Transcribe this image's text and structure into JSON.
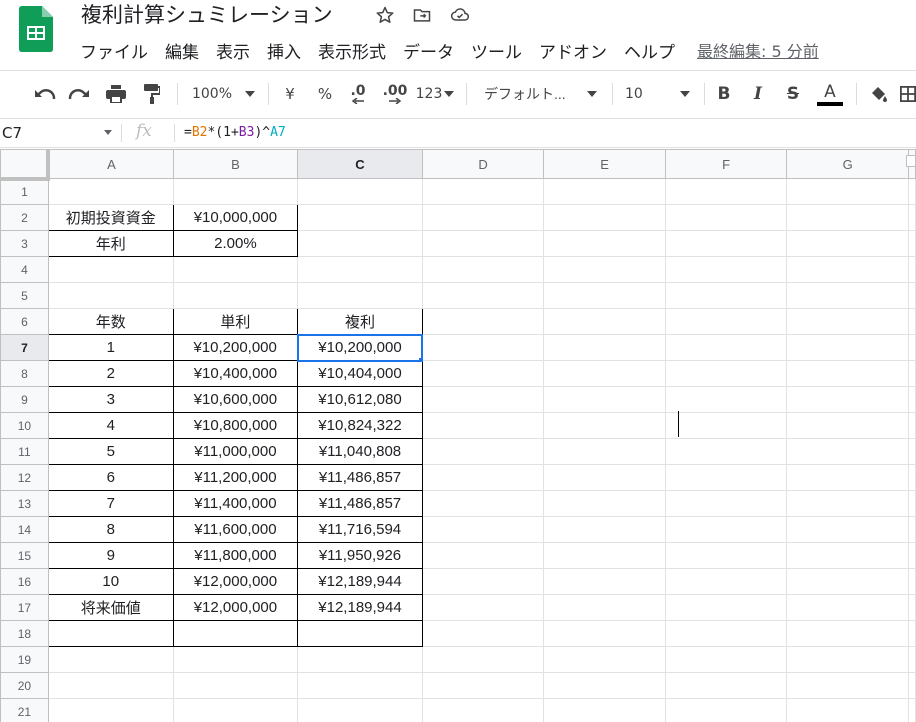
{
  "app": {
    "doc_title": "複利計算シュミレーション",
    "brand_color": "#0f9d58",
    "title_icons": [
      "star-icon",
      "move-to-folder-icon",
      "cloud-saved-icon"
    ]
  },
  "menu": {
    "items": [
      "ファイル",
      "編集",
      "表示",
      "挿入",
      "表示形式",
      "データ",
      "ツール",
      "アドオン",
      "ヘルプ"
    ],
    "last_edit": "最終編集: 5 分前"
  },
  "toolbar": {
    "zoom": "100%",
    "currency": "¥",
    "percent": "%",
    "decrease_decimal": ".0",
    "increase_decimal": ".00",
    "more_formats": "123",
    "font": "デフォルト...",
    "font_size": "10",
    "bold": "B",
    "italic": "I",
    "strikethrough": "S",
    "text_color": "A"
  },
  "formula_bar": {
    "cell_ref": "C7",
    "fx": "fx",
    "formula_parts": [
      {
        "t": "=",
        "c": "#202124"
      },
      {
        "t": "B2",
        "c": "#e37400"
      },
      {
        "t": "*(1+",
        "c": "#202124"
      },
      {
        "t": "B3",
        "c": "#7b1fa2"
      },
      {
        "t": ")^",
        "c": "#202124"
      },
      {
        "t": "A7",
        "c": "#00acc1"
      }
    ]
  },
  "sheet": {
    "columns": [
      "A",
      "B",
      "C",
      "D",
      "E",
      "F",
      "G"
    ],
    "selected_column": "C",
    "selected_row": 7,
    "rows": [
      {
        "n": "1",
        "a": "",
        "b": "",
        "c": ""
      },
      {
        "n": "2",
        "a": "初期投資資金",
        "b": "¥10,000,000",
        "c": ""
      },
      {
        "n": "3",
        "a": "年利",
        "b": "2.00%",
        "c": ""
      },
      {
        "n": "4",
        "a": "",
        "b": "",
        "c": ""
      },
      {
        "n": "5",
        "a": "",
        "b": "",
        "c": ""
      },
      {
        "n": "6",
        "a": "年数",
        "b": "単利",
        "c": "複利"
      },
      {
        "n": "7",
        "a": "1",
        "b": "¥10,200,000",
        "c": "¥10,200,000"
      },
      {
        "n": "8",
        "a": "2",
        "b": "¥10,400,000",
        "c": "¥10,404,000"
      },
      {
        "n": "9",
        "a": "3",
        "b": "¥10,600,000",
        "c": "¥10,612,080"
      },
      {
        "n": "10",
        "a": "4",
        "b": "¥10,800,000",
        "c": "¥10,824,322"
      },
      {
        "n": "11",
        "a": "5",
        "b": "¥11,000,000",
        "c": "¥11,040,808"
      },
      {
        "n": "12",
        "a": "6",
        "b": "¥11,200,000",
        "c": "¥11,486,857"
      },
      {
        "n": "13",
        "a": "7",
        "b": "¥11,400,000",
        "c": "¥11,486,857"
      },
      {
        "n": "14",
        "a": "8",
        "b": "¥11,600,000",
        "c": "¥11,716,594"
      },
      {
        "n": "15",
        "a": "9",
        "b": "¥11,800,000",
        "c": "¥11,950,926"
      },
      {
        "n": "16",
        "a": "10",
        "b": "¥12,000,000",
        "c": "¥12,189,944"
      },
      {
        "n": "17",
        "a": "将来価値",
        "b": "¥12,000,000",
        "c": "¥12,189,944"
      },
      {
        "n": "18",
        "a": "",
        "b": "",
        "c": ""
      },
      {
        "n": "19",
        "a": "",
        "b": "",
        "c": ""
      },
      {
        "n": "20",
        "a": "",
        "b": "",
        "c": ""
      },
      {
        "n": "21",
        "a": "",
        "b": "",
        "c": ""
      }
    ]
  }
}
